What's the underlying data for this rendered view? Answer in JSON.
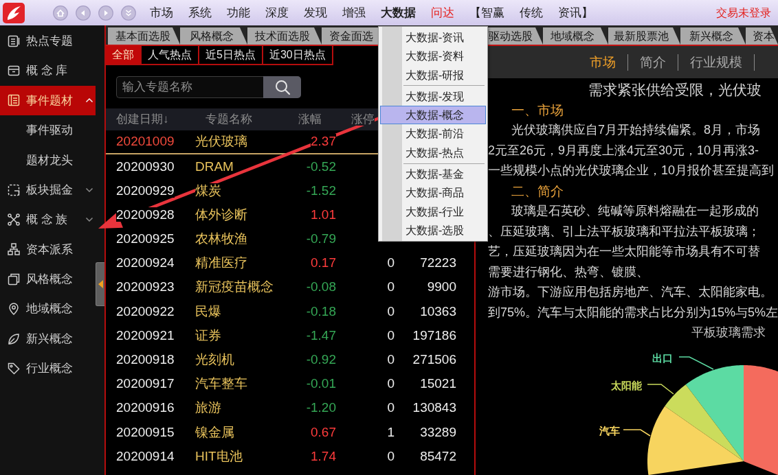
{
  "app_bar": {
    "menu": [
      {
        "label": "市场",
        "open": false,
        "color": "#1e1e1e"
      },
      {
        "label": "系统",
        "open": false,
        "color": "#1e1e1e"
      },
      {
        "label": "功能",
        "open": false,
        "color": "#1e1e1e"
      },
      {
        "label": "深度",
        "open": false,
        "color": "#1e1e1e"
      },
      {
        "label": "发现",
        "open": false,
        "color": "#1e1e1e"
      },
      {
        "label": "增强",
        "open": false,
        "color": "#1e1e1e"
      },
      {
        "label": "大数据",
        "open": true,
        "color": "#1e1e1e"
      },
      {
        "label": "问达",
        "open": false,
        "color": "#e5201d"
      },
      {
        "label": "【智赢",
        "open": false,
        "color": "#1e1e1e"
      },
      {
        "label": "传统",
        "open": false,
        "color": "#1e1e1e"
      },
      {
        "label": "资讯】",
        "open": false,
        "color": "#1e1e1e"
      }
    ],
    "login_status": "交易未登录"
  },
  "sidebar": {
    "items": [
      {
        "label": "热点专题",
        "selected": false
      },
      {
        "label": "概 念 库",
        "selected": false
      },
      {
        "label": "事件题材",
        "selected": true,
        "expanded": true,
        "children": [
          {
            "label": "事件驱动",
            "selected": false
          },
          {
            "label": "题材龙头",
            "selected": false
          }
        ]
      },
      {
        "label": "板块掘金",
        "selected": false,
        "expanded": false
      },
      {
        "label": "概 念 族",
        "selected": false,
        "expanded": false
      },
      {
        "label": "资本派系",
        "selected": false
      },
      {
        "label": "风格概念",
        "selected": false
      },
      {
        "label": "地域概念",
        "selected": false
      },
      {
        "label": "新兴概念",
        "selected": false
      },
      {
        "label": "行业概念",
        "selected": false
      }
    ]
  },
  "category_tabs": [
    {
      "label": "基本面选股",
      "selected": false
    },
    {
      "label": "风格概念",
      "selected": false
    },
    {
      "label": "技术面选股",
      "selected": false
    },
    {
      "label": "资金面选",
      "selected": false
    },
    {
      "label": "驱动选股",
      "selected": false
    },
    {
      "label": "地域概念",
      "selected": false
    },
    {
      "label": "最新股票池",
      "selected": false
    },
    {
      "label": "新兴概念",
      "selected": false
    },
    {
      "label": "资本",
      "selected": false
    }
  ],
  "filter_tabs": [
    {
      "label": "全部",
      "selected": true
    },
    {
      "label": "人气热点",
      "selected": false
    },
    {
      "label": "近5日热点",
      "selected": false
    },
    {
      "label": "近30日热点",
      "selected": false
    }
  ],
  "search": {
    "placeholder": "输入专题名称"
  },
  "table": {
    "columns": [
      "创建日期↓",
      "专题名称",
      "涨幅",
      "涨停"
    ],
    "rows": [
      {
        "selected": true,
        "rising": true,
        "cells": [
          "20201009",
          "光伏玻璃",
          "2.37"
        ]
      },
      {
        "selected": false,
        "rising": false,
        "cells": [
          "20200930",
          "DRAM",
          "-0.52"
        ]
      },
      {
        "selected": false,
        "rising": false,
        "cells": [
          "20200929",
          "煤炭",
          "-1.52"
        ]
      },
      {
        "selected": false,
        "rising": true,
        "cells": [
          "20200928",
          "体外诊断",
          "1.01"
        ]
      },
      {
        "selected": false,
        "rising": false,
        "cells": [
          "20200925",
          "农林牧渔",
          "-0.79"
        ]
      },
      {
        "selected": false,
        "rising": true,
        "cells": [
          "20200924",
          "精准医疗",
          "0.17",
          "0",
          "72223"
        ]
      },
      {
        "selected": false,
        "rising": false,
        "cells": [
          "20200923",
          "新冠疫苗概念",
          "-0.08",
          "0",
          "9900"
        ]
      },
      {
        "selected": false,
        "rising": false,
        "cells": [
          "20200922",
          "民爆",
          "-0.18",
          "0",
          "10363"
        ]
      },
      {
        "selected": false,
        "rising": false,
        "cells": [
          "20200921",
          "证券",
          "-1.47",
          "0",
          "197186"
        ]
      },
      {
        "selected": false,
        "rising": false,
        "cells": [
          "20200918",
          "光刻机",
          "-0.92",
          "0",
          "271506"
        ]
      },
      {
        "selected": false,
        "rising": false,
        "cells": [
          "20200917",
          "汽车整车",
          "-0.01",
          "0",
          "15021"
        ]
      },
      {
        "selected": false,
        "rising": false,
        "cells": [
          "20200916",
          "旅游",
          "-1.20",
          "0",
          "130843"
        ]
      },
      {
        "selected": false,
        "rising": true,
        "cells": [
          "20200915",
          "镍金属",
          "0.67",
          "1",
          "33289"
        ]
      },
      {
        "selected": false,
        "rising": true,
        "cells": [
          "20200914",
          "HIT电池",
          "1.74",
          "0",
          "85472"
        ]
      }
    ]
  },
  "dropdown": {
    "groups": [
      {
        "items": [
          {
            "label": "大数据-资讯",
            "selected": false
          },
          {
            "label": "大数据-资料",
            "selected": false
          },
          {
            "label": "大数据-研报",
            "selected": false
          }
        ]
      },
      {
        "items": [
          {
            "label": "大数据-发现",
            "selected": false
          },
          {
            "label": "大数据-概念",
            "selected": true
          },
          {
            "label": "大数据-前沿",
            "selected": false
          },
          {
            "label": "大数据-热点",
            "selected": false
          }
        ]
      },
      {
        "items": [
          {
            "label": "大数据-基金",
            "selected": false
          },
          {
            "label": "大数据-商品",
            "selected": false
          },
          {
            "label": "大数据-行业",
            "selected": false
          },
          {
            "label": "大数据-选股",
            "selected": false
          }
        ]
      }
    ]
  },
  "detail": {
    "tabs": [
      {
        "label": "市场",
        "selected": true
      },
      {
        "label": "简介",
        "selected": false
      },
      {
        "label": "行业规模",
        "selected": false
      }
    ],
    "title": "需求紧张供给受限，光伏玻",
    "sections": [
      {
        "heading": "一、市场",
        "paragraphs": [
          {
            "lines": [
              "光伏玻璃供应自7月开始持续偏紧。8月，市场",
              "2元至26元，9月再度上涨4元至30元，10月再涨3-",
              "一些规模小点的光伏玻璃企业，10月报价甚至提高到"
            ]
          }
        ]
      },
      {
        "heading": "二、简介",
        "paragraphs": [
          {
            "lines": [
              "玻璃是石英砂、纯碱等原料熔融在一起形成的",
              "、压延玻璃、引上法平板玻璃和平拉法平板玻璃；",
              "艺，压延玻璃因为在一些太阳能等市场具有不可替",
              "需要进行钢化、热弯、镀膜、",
              "游市场。下游应用包括房地产、汽车、太阳能家电。",
              "到75%。汽车与太阳能的需求占比分别为15%与5%左"
            ]
          }
        ]
      }
    ]
  },
  "pie_chart": {
    "title": "平板玻璃需求",
    "slices": [
      {
        "label": "出口",
        "color": "#5cdba3"
      },
      {
        "label": "太阳能",
        "color": "#cbdc5c"
      },
      {
        "label": "汽车",
        "color": "#f7d45f"
      },
      {
        "color": "#f46b5d"
      }
    ]
  }
}
